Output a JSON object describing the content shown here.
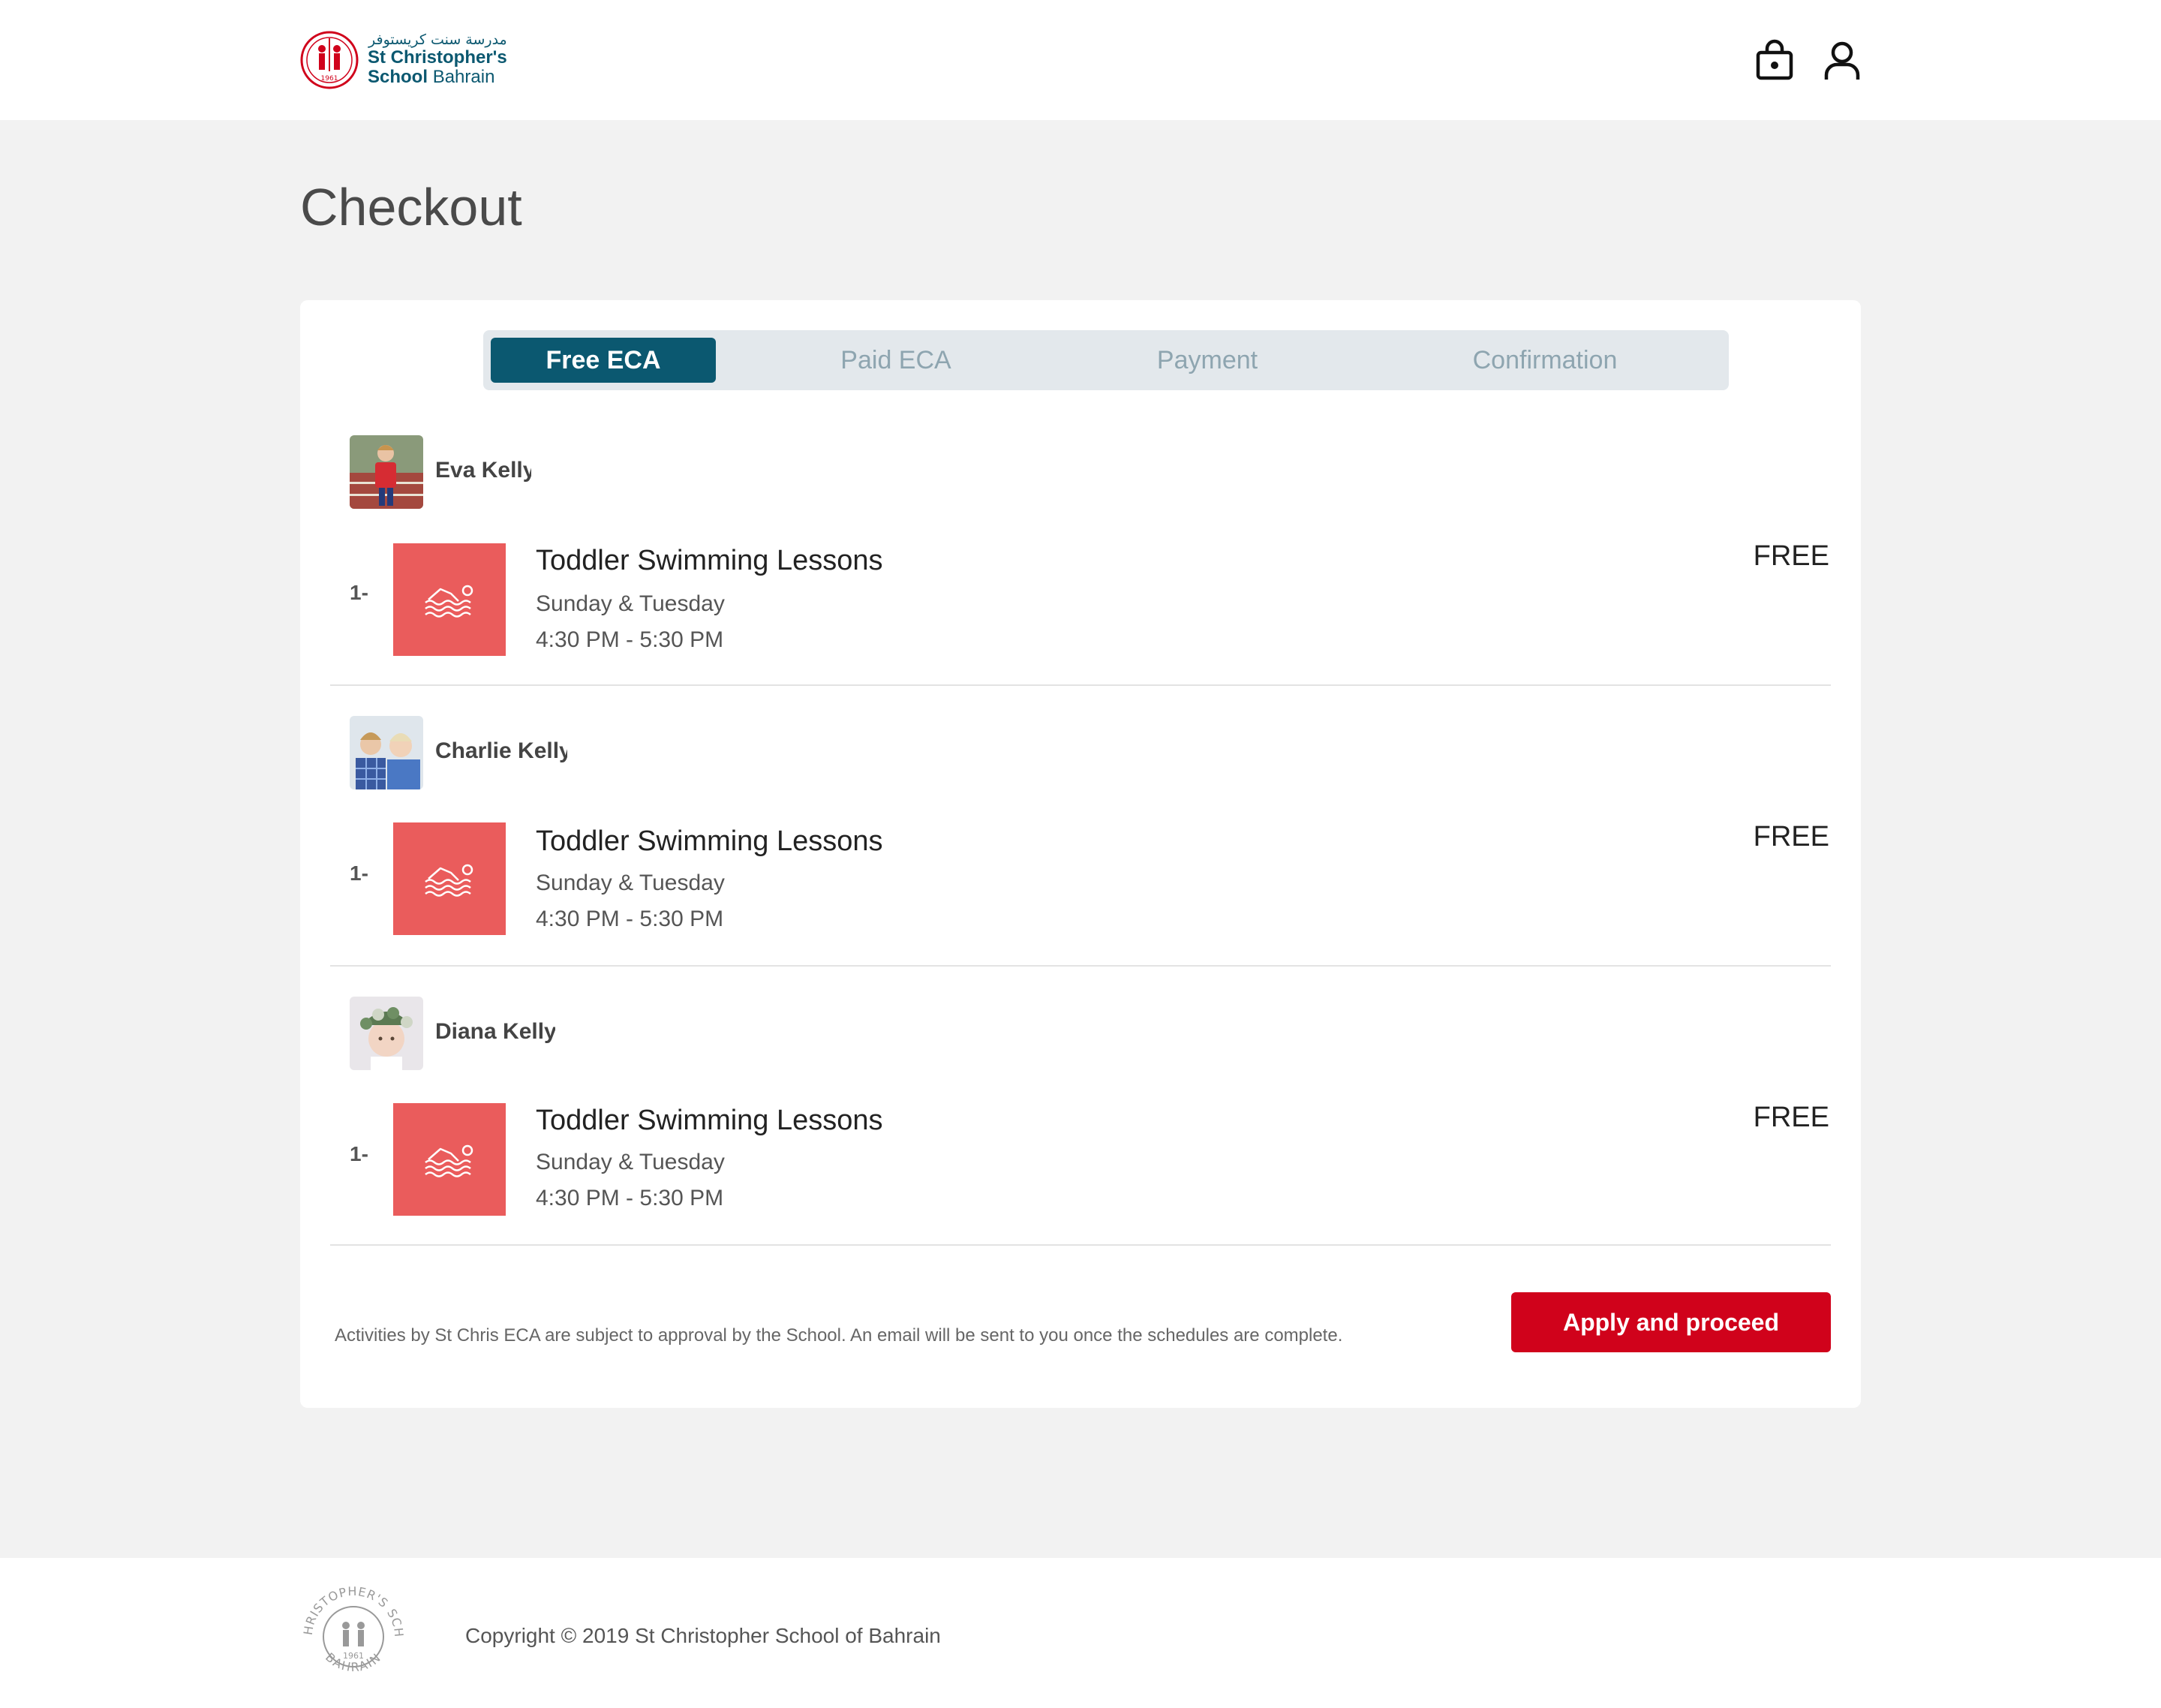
{
  "header": {
    "logo": {
      "arabic": "مدرسة سنت كريستوفر",
      "name_line1": "St Christopher's",
      "name_line2_bold": "School",
      "name_line2_light": "Bahrain",
      "emblem_year": "1961"
    },
    "icons": [
      "shopping-bag-icon",
      "user-icon"
    ]
  },
  "page": {
    "title": "Checkout"
  },
  "steps": [
    {
      "label": "Free ECA",
      "active": true
    },
    {
      "label": "Paid ECA",
      "active": false
    },
    {
      "label": "Payment",
      "active": false
    },
    {
      "label": "Confirmation",
      "active": false
    }
  ],
  "children": [
    {
      "name": "Eva Kelly",
      "items": [
        {
          "number": "1-",
          "title": "Toddler Swimming Lessons",
          "days": "Sunday & Tuesday",
          "time": "4:30 PM - 5:30 PM",
          "price": "FREE",
          "icon": "swimmer-icon"
        }
      ]
    },
    {
      "name": "Charlie Kelly",
      "items": [
        {
          "number": "1-",
          "title": "Toddler Swimming Lessons",
          "days": "Sunday & Tuesday",
          "time": "4:30 PM - 5:30 PM",
          "price": "FREE",
          "icon": "swimmer-icon"
        }
      ]
    },
    {
      "name": "Diana Kelly",
      "items": [
        {
          "number": "1-",
          "title": "Toddler Swimming Lessons",
          "days": "Sunday & Tuesday",
          "time": "4:30 PM - 5:30 PM",
          "price": "FREE",
          "icon": "swimmer-icon"
        }
      ]
    }
  ],
  "disclaimer": "Activities by St Chris ECA are subject to approval by the School. An email will be sent to you once the schedules are complete.",
  "actions": {
    "apply_label": "Apply and proceed"
  },
  "footer": {
    "seal_top": "ST CHRISTOPHER'S SCHOOL",
    "seal_bottom": "BAHRAIN",
    "seal_year": "1961",
    "copyright": "Copyright © 2019 St Christopher School of Bahrain"
  },
  "colors": {
    "brand_teal": "#0b5870",
    "accent_red": "#d0021b",
    "activity_thumb": "#ea5c5c",
    "step_inactive_text": "#8ea5b0"
  }
}
